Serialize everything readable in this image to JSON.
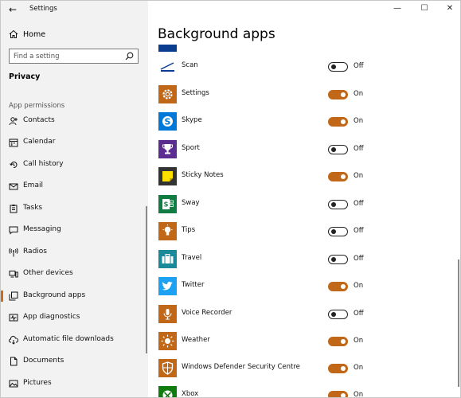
{
  "window": {
    "app_title": "Settings",
    "controls": {
      "minimize": "—",
      "maximize": "☐",
      "close": "✕"
    }
  },
  "sidebar": {
    "home_label": "Home",
    "search_placeholder": "Find a setting",
    "section_title": "Privacy",
    "group_label": "App permissions",
    "items": [
      {
        "label": "Contacts",
        "icon": "contacts-icon"
      },
      {
        "label": "Calendar",
        "icon": "calendar-icon"
      },
      {
        "label": "Call history",
        "icon": "call-history-icon"
      },
      {
        "label": "Email",
        "icon": "email-icon"
      },
      {
        "label": "Tasks",
        "icon": "tasks-icon"
      },
      {
        "label": "Messaging",
        "icon": "messaging-icon"
      },
      {
        "label": "Radios",
        "icon": "radios-icon"
      },
      {
        "label": "Other devices",
        "icon": "other-devices-icon"
      },
      {
        "label": "Background apps",
        "icon": "background-apps-icon",
        "active": true
      },
      {
        "label": "App diagnostics",
        "icon": "app-diagnostics-icon"
      },
      {
        "label": "Automatic file downloads",
        "icon": "cloud-download-icon"
      },
      {
        "label": "Documents",
        "icon": "documents-icon"
      },
      {
        "label": "Pictures",
        "icon": "pictures-icon"
      }
    ]
  },
  "main": {
    "title": "Background apps",
    "apps": [
      {
        "name": "Scan",
        "state": "Off",
        "on": false,
        "tile_color": "#ffffff",
        "icon": "scan-icon"
      },
      {
        "name": "Settings",
        "state": "On",
        "on": true,
        "tile_color": "#c06818",
        "icon": "gear-icon"
      },
      {
        "name": "Skype",
        "state": "On",
        "on": true,
        "tile_color": "#0078d7",
        "icon": "skype-icon"
      },
      {
        "name": "Sport",
        "state": "Off",
        "on": false,
        "tile_color": "#5c2d91",
        "icon": "trophy-icon"
      },
      {
        "name": "Sticky Notes",
        "state": "On",
        "on": true,
        "tile_color": "#333333",
        "icon": "sticky-note-icon"
      },
      {
        "name": "Sway",
        "state": "Off",
        "on": false,
        "tile_color": "#107c41",
        "icon": "sway-icon"
      },
      {
        "name": "Tips",
        "state": "Off",
        "on": false,
        "tile_color": "#c06818",
        "icon": "lightbulb-icon"
      },
      {
        "name": "Travel",
        "state": "Off",
        "on": false,
        "tile_color": "#1a8a9a",
        "icon": "suitcase-icon"
      },
      {
        "name": "Twitter",
        "state": "On",
        "on": true,
        "tile_color": "#1da1f2",
        "icon": "twitter-bird-icon"
      },
      {
        "name": "Voice Recorder",
        "state": "Off",
        "on": false,
        "tile_color": "#c06818",
        "icon": "microphone-icon"
      },
      {
        "name": "Weather",
        "state": "On",
        "on": true,
        "tile_color": "#c06818",
        "icon": "sun-icon"
      },
      {
        "name": "Windows Defender Security Centre",
        "state": "On",
        "on": true,
        "tile_color": "#c06818",
        "icon": "shield-icon"
      },
      {
        "name": "Xbox",
        "state": "On",
        "on": true,
        "tile_color": "#107c10",
        "icon": "xbox-icon"
      }
    ]
  }
}
